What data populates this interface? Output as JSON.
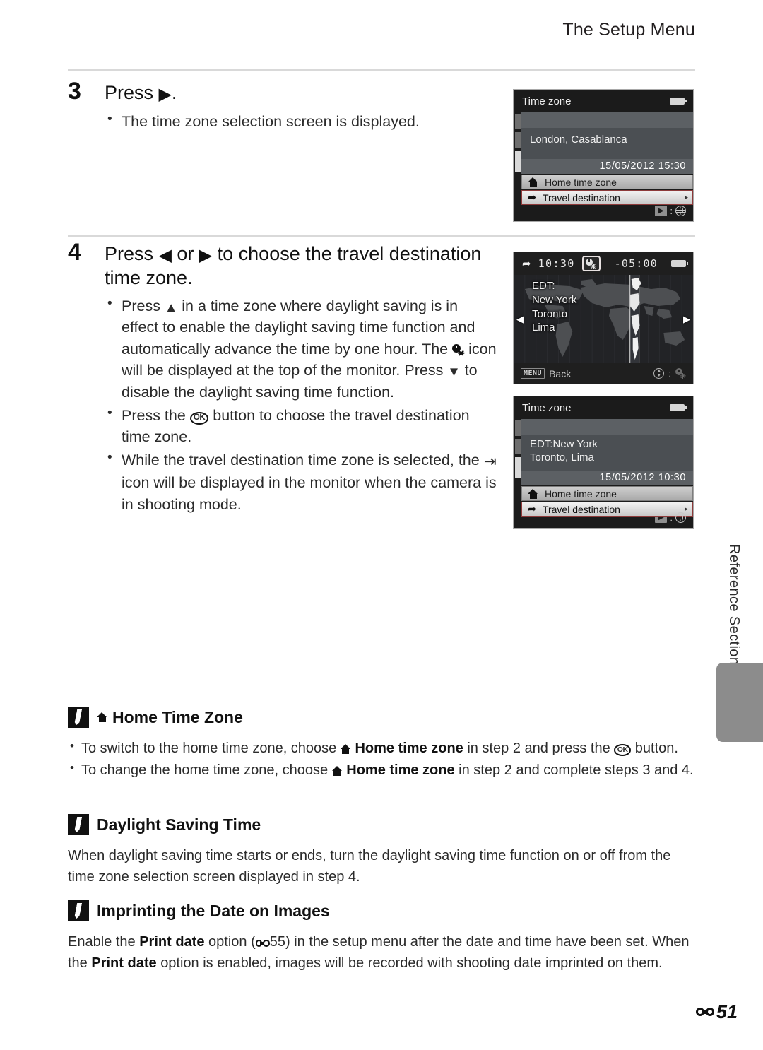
{
  "header": {
    "title": "The Setup Menu"
  },
  "folio": {
    "page": "51",
    "mark_icon": "nikon-reference-mark-icon"
  },
  "side_tab": {
    "label": "Reference Section"
  },
  "steps": [
    {
      "number": "3",
      "title_prefix": "Press",
      "title_glyph": "right-triangle-icon",
      "title_suffix": ".",
      "bullets": [
        {
          "text": "The time zone selection screen is displayed."
        }
      ]
    },
    {
      "number": "4",
      "title_part1": "Press",
      "title_glyph_left": "left-triangle-icon",
      "title_or": "or",
      "title_glyph_right": "right-triangle-icon",
      "title_part2": "to choose the travel destination time zone.",
      "bullets": [
        {
          "seg1": "Press",
          "glyph1": "up-triangle-icon",
          "seg2": "in a time zone where daylight saving is in effect to enable the daylight saving time function and automatically advance the time by one hour. The",
          "glyph2": "daylight-saving-icon",
          "seg3": "icon will be displayed at the top of the monitor. Press",
          "glyph3": "down-triangle-icon",
          "seg4": "to disable the daylight saving time function."
        },
        {
          "seg1": "Press the",
          "glyph1": "ok-button-icon",
          "seg2": "button to choose the travel destination time zone."
        },
        {
          "seg1": "While the travel destination time zone is selected, the",
          "glyph1": "travel-destination-plane-icon",
          "seg2": "icon will be displayed in the monitor when the camera is in shooting mode."
        }
      ]
    }
  ],
  "notes": [
    {
      "id": "home",
      "icon": "pencil-note-icon",
      "title_glyph": "home-house-icon",
      "title": "Home Time Zone",
      "items": [
        {
          "seg1": "To switch to the home time zone, choose",
          "glyph1": "home-house-icon",
          "bold1": "Home time zone",
          "seg2": "in step 2 and press the",
          "glyph2": "ok-button-icon",
          "seg3": "button."
        },
        {
          "seg1": "To change the home time zone, choose",
          "glyph1": "home-house-icon",
          "bold1": "Home time zone",
          "seg2": "in step 2 and complete steps 3 and 4."
        }
      ]
    },
    {
      "id": "dst",
      "icon": "pencil-note-icon",
      "title": "Daylight Saving Time",
      "paragraph": "When daylight saving time starts or ends, turn the daylight saving time function on or off from the time zone selection screen displayed in step 4."
    },
    {
      "id": "print",
      "icon": "pencil-note-icon",
      "title": "Imprinting the Date on Images",
      "para1_seg1": "Enable the",
      "para1_bold1": "Print date",
      "para1_seg2": "option (",
      "para1_ref": "55",
      "para1_seg3": ") in the setup menu after the date and time have been set.",
      "para2_seg1": "When the",
      "para2_bold1": "Print date",
      "para2_seg2": "option is enabled, images will be recorded with shooting date imprinted on them."
    }
  ],
  "screens": {
    "timezone_home": {
      "title": "Time zone",
      "battery_icon": "battery-full-icon",
      "city": "London, Casablanca",
      "datetime": "15/05/2012 15:30",
      "rows": [
        {
          "icon": "home-house-icon",
          "label": "Home time zone",
          "selected": false
        },
        {
          "icon": "plane-icon",
          "label": "Travel destination",
          "selected": true,
          "chevron": "▸"
        }
      ],
      "footer": {
        "key_icon": "play-button-icon",
        "separator": ":",
        "value_icon": "globe-icon"
      }
    },
    "world_map": {
      "plane_icon": "plane-icon",
      "time": "10:30",
      "dst_icon": "daylight-saving-icon",
      "utc_offset": "-05:00",
      "battery_icon": "battery-full-icon",
      "cities": [
        "EDT:",
        "New York",
        "Toronto",
        "Lima"
      ],
      "nav_left_icon": "left-triangle-icon",
      "nav_right_icon": "right-triangle-icon",
      "footer": {
        "menu_key": "MENU",
        "back_label": "Back",
        "updown_icon": "up-down-key-icon",
        "separator": ":",
        "value_icon": "daylight-saving-icon"
      }
    },
    "timezone_travel": {
      "title": "Time zone",
      "battery_icon": "battery-full-icon",
      "city_line1": "EDT:New York",
      "city_line2": "Toronto, Lima",
      "datetime": "15/05/2012 10:30",
      "rows": [
        {
          "icon": "home-house-icon",
          "label": "Home time zone",
          "selected": false
        },
        {
          "icon": "plane-icon",
          "label": "Travel destination",
          "selected": true,
          "chevron": "▸"
        }
      ],
      "footer": {
        "key_icon": "play-button-icon",
        "separator": ":",
        "value_icon": "globe-icon"
      }
    }
  },
  "colors": {
    "page_bg": "#ffffff",
    "text": "#2b2b2b",
    "rule": "#d9d9d9",
    "tab_gray": "#8c8c8c",
    "screen_bg": "#1b1b1b",
    "screen_panel": "#4b4f53",
    "selected_red_border": "#8d3a3a"
  }
}
